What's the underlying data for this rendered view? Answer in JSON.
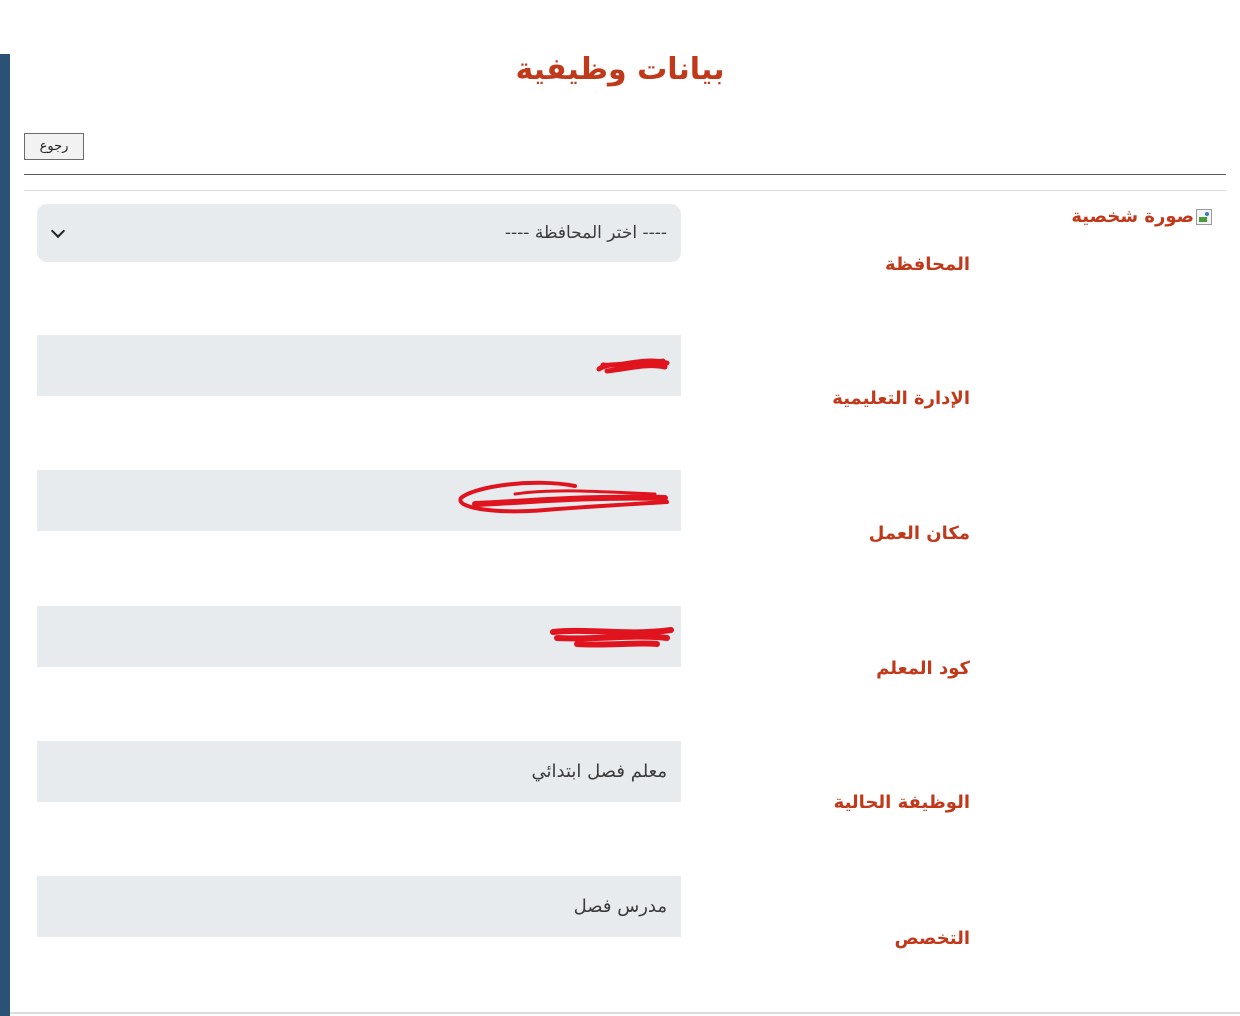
{
  "page": {
    "title": "بيانات وظيفية",
    "back_label": "رجوع",
    "profile_photo_alt": "صورة شخصية"
  },
  "form": {
    "governorate": {
      "label": "المحافظة",
      "placeholder": "---- اختر المحافظة ----"
    },
    "educational_administration": {
      "label": "الإدارة التعليمية",
      "value": "",
      "redacted": true
    },
    "workplace": {
      "label": "مكان العمل",
      "value": "",
      "redacted": true
    },
    "teacher_code": {
      "label": "كود المعلم",
      "value": "",
      "redacted": true
    },
    "current_job": {
      "label": "الوظيفة الحالية",
      "value": "معلم فصل ابتدائي"
    },
    "specialization": {
      "label": "التخصص",
      "value": "مدرس فصل"
    }
  },
  "colors": {
    "accent": "#c0391b",
    "field_bg": "#e8ebee",
    "sidebar": "#2b5275",
    "redaction": "#e0141e"
  },
  "icons": {
    "select_arrow": "chevron-down-icon",
    "profile_image": "broken-image-icon"
  }
}
